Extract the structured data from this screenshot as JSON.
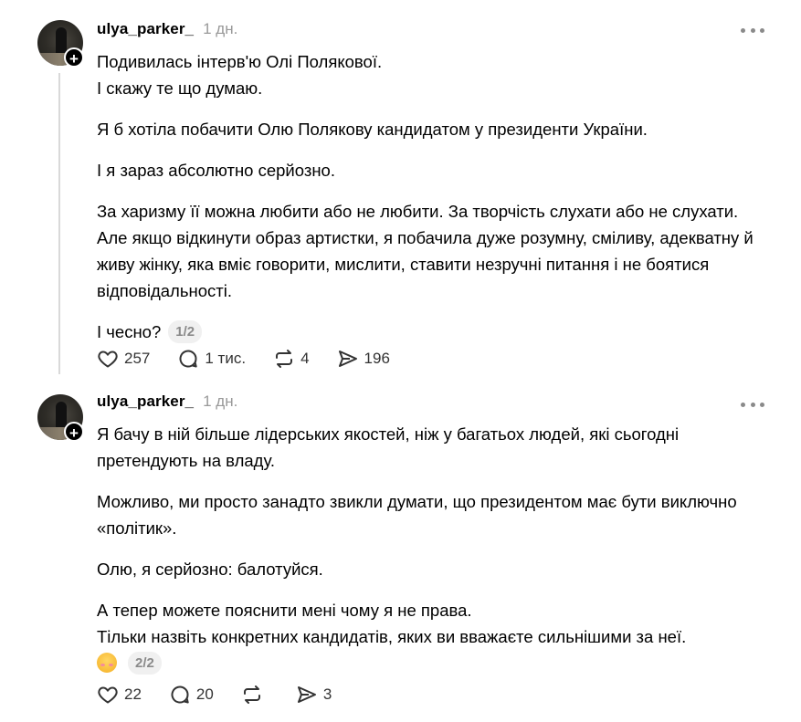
{
  "posts": [
    {
      "username": "ulya_parker_",
      "time": "1 дн.",
      "lines": [
        "Подивилась інтерв'ю Олі Полякової.",
        "І скажу те що думаю."
      ],
      "paragraphs": [
        "Я б хотіла побачити Олю Полякову кандидатом у президенти України.",
        "І я зараз абсолютно серйозно.",
        "За харизму її можна любити або не любити. За творчість слухати або не слухати. Але якщо відкинути образ артистки, я побачила дуже розумну, сміливу, адекватну й живу жінку, яка вміє говорити, мислити, ставити незручні питання і не боятися відповідальності."
      ],
      "last_line": "І чесно?",
      "pager": "1/2",
      "likes": "257",
      "replies": "1 тис.",
      "reposts": "4",
      "shares": "196"
    },
    {
      "username": "ulya_parker_",
      "time": "1 дн.",
      "paragraphs": [
        "Я бачу в ній більше лідерських якостей, ніж у багатьох людей, які сьогодні претендують на владу.",
        "Можливо, ми просто занадто звикли думати, що президентом має бути виключно «політик».",
        "Олю, я серйозно: балотуйся."
      ],
      "lines": [
        "А тепер можете пояснити мені чому я не права.",
        "Тільки назвіть конкретних кандидатів, яких ви вважаєте сильнішими за неї."
      ],
      "emoji": "smiling-blush-emoji",
      "pager": "2/2",
      "likes": "22",
      "replies": "20",
      "reposts": "",
      "shares": "3"
    }
  ],
  "icons": {
    "more": "more-horizontal-icon",
    "like": "heart-icon",
    "reply": "comment-icon",
    "repost": "repost-icon",
    "share": "send-icon",
    "follow": "plus-icon"
  }
}
